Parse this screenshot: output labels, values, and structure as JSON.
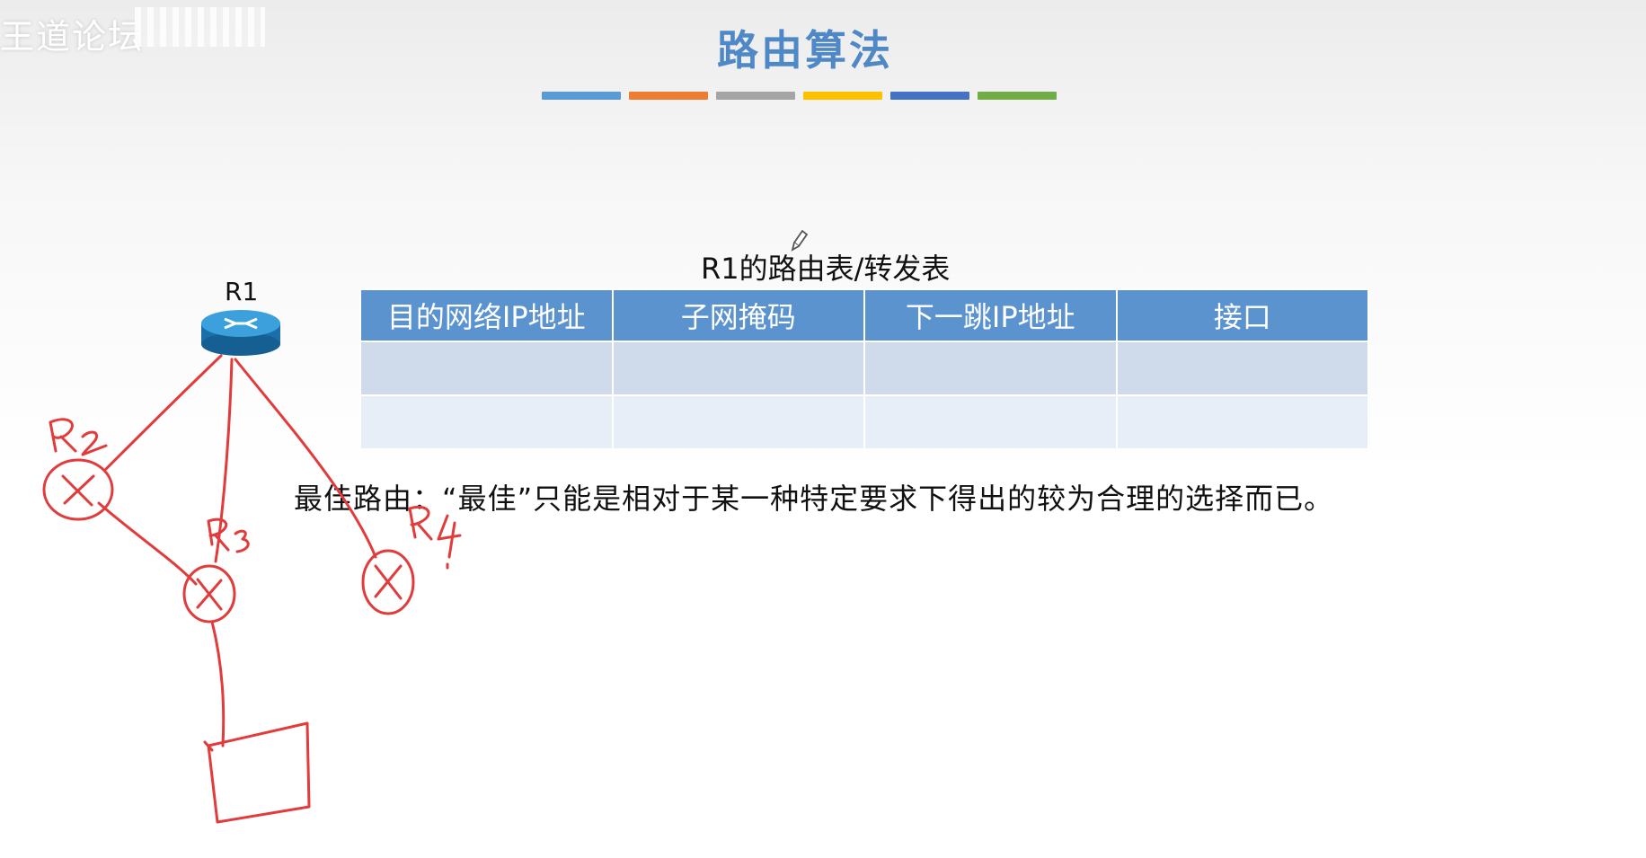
{
  "watermark": {
    "text": "王道论坛"
  },
  "slide": {
    "title": "路由算法",
    "title_bar_colors": [
      "#5b9bd5",
      "#ed7d31",
      "#a5a5a5",
      "#ffc000",
      "#4472c4",
      "#70ad47"
    ]
  },
  "table": {
    "caption": "R1的路由表/转发表",
    "headers": [
      "目的网络IP地址",
      "子网掩码",
      "下一跳IP地址",
      "接口"
    ],
    "rows": [
      [
        "",
        "",
        "",
        ""
      ],
      [
        "",
        "",
        "",
        ""
      ]
    ]
  },
  "note": "最佳路由：“最佳”只能是相对于某一种特定要求下得出的较为合理的选择而已。",
  "diagram": {
    "router_label": "R1",
    "router_icon": "router-icon",
    "sketch_color": "#e23b3b",
    "handwritten_labels": [
      "R2",
      "R3",
      "R4"
    ]
  }
}
